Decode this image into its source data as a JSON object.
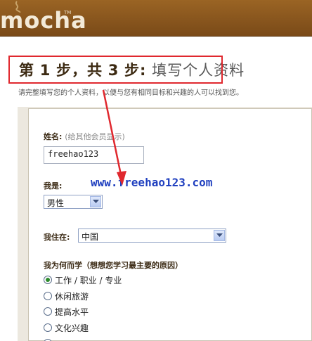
{
  "header": {
    "logo_text": "mocha",
    "logo_tm": "TM"
  },
  "title": {
    "prefix": "第",
    "step_current": "1",
    "mid": "步，共",
    "step_total": "3",
    "suffix": "步:",
    "subtitle": "填写个人资料"
  },
  "intro": "请完整填写您的个人资料，以便与您有相同目标和兴趣的人可以找到您。",
  "form": {
    "name_label": "姓名:",
    "name_hint": "(给其他会员显示)",
    "name_value": "freehao123",
    "gender_label": "我是:",
    "gender_value": "男性",
    "location_label": "我住在:",
    "location_value": "中国",
    "reason_label": "我为何而学（想想您学习最主要的原因）",
    "reasons": [
      {
        "label": "工作 / 职业 / 专业",
        "checked": true
      },
      {
        "label": "休闲旅游",
        "checked": false
      },
      {
        "label": "提高水平",
        "checked": false
      },
      {
        "label": "文化兴趣",
        "checked": false
      }
    ]
  },
  "watermark": "www.freehao123.com",
  "colors": {
    "header_brown": "#8a5620",
    "annotation_red": "#e0282e",
    "watermark_blue": "#1f3fbf"
  }
}
